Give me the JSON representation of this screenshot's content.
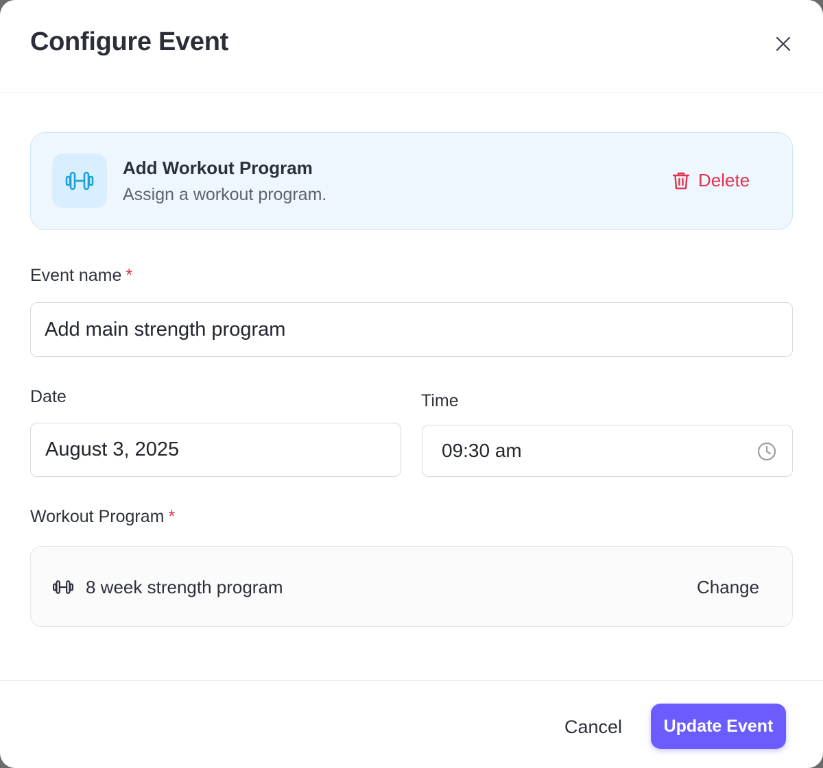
{
  "header": {
    "title": "Configure Event",
    "close_icon": "close-icon"
  },
  "program_card": {
    "icon": "dumbbell-icon",
    "title": "Add Workout Program",
    "subtitle": "Assign a workout program.",
    "delete_icon": "trash-icon",
    "delete_label": "Delete"
  },
  "form": {
    "event_name": {
      "label": "Event name",
      "required_mark": "*",
      "value": "Add main strength program"
    },
    "date": {
      "label": "Date",
      "value": "August 3, 2025"
    },
    "time": {
      "label": "Time",
      "value": "09:30 am",
      "icon": "clock-icon"
    },
    "workout_program": {
      "label": "Workout Program",
      "required_mark": "*",
      "icon": "dumbbell-icon",
      "value": "8 week strength program",
      "change_label": "Change"
    }
  },
  "footer": {
    "cancel_label": "Cancel",
    "update_label": "Update Event"
  },
  "colors": {
    "accent": "#6a5cff",
    "danger": "#e0334f",
    "card_bg": "#eef7fe",
    "icon_blue": "#1ea0d9"
  }
}
